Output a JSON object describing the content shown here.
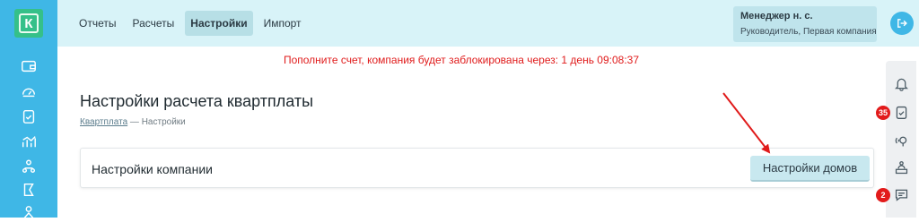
{
  "logo": {
    "letter": "К"
  },
  "sidebar": {
    "icons": [
      "wallet-icon",
      "gauge-icon",
      "clipboard-check-icon",
      "analytics-icon",
      "users-icon",
      "flag-icon",
      "person-icon"
    ]
  },
  "header": {
    "tabs": [
      {
        "label": "Отчеты",
        "active": false
      },
      {
        "label": "Расчеты",
        "active": false
      },
      {
        "label": "Настройки",
        "active": true
      },
      {
        "label": "Импорт",
        "active": false
      }
    ],
    "user": {
      "name": "Менеджер н. с.",
      "role": "Руководитель, Первая компания"
    }
  },
  "warning": "Пополните счет, компания будет заблокирована через: 1 день 09:08:37",
  "page": {
    "title": "Настройки расчета квартплаты",
    "breadcrumb": {
      "link": "Квартплата",
      "separator": " — ",
      "current": "Настройки"
    }
  },
  "card": {
    "title": "Настройки компании",
    "button": "Настройки домов"
  },
  "rightbar": {
    "icons": [
      "bell-icon",
      "task-icon",
      "broadcast-icon",
      "support-desk-icon",
      "chat-icon"
    ],
    "badges": {
      "tasks": "35",
      "chat": "2"
    }
  },
  "colors": {
    "sidebar": "#3fb7e6",
    "header": "#d8f3f8",
    "logo": "#35c089",
    "warning": "#e01b1b",
    "badge": "#e21b1b"
  }
}
